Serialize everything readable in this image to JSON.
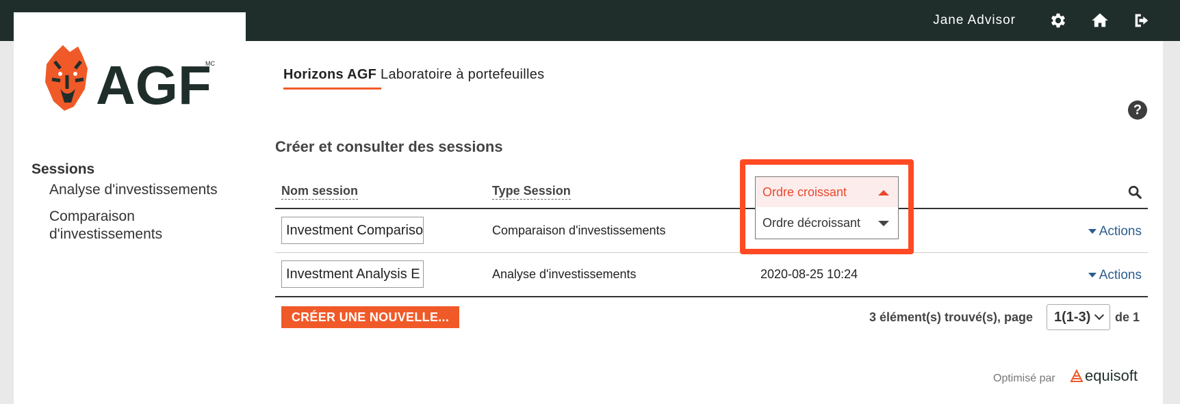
{
  "header": {
    "user_name": "Jane Advisor",
    "icons": [
      "gear-icon",
      "home-icon",
      "logout-icon"
    ]
  },
  "brand": {
    "logo_text": "AGF",
    "logo_mark": "MC",
    "accent_color": "#f05a28",
    "dark_color": "#1f2e2b"
  },
  "sidebar": {
    "title": "Sessions",
    "items": [
      {
        "label": "Analyse d'investissements"
      },
      {
        "label": "Comparaison d'investissements"
      }
    ]
  },
  "app": {
    "title_bold": "Horizons AGF",
    "title_rest": " Laboratoire à portefeuilles"
  },
  "main": {
    "section_title": "Créer et consulter des sessions",
    "columns": {
      "name": "Nom session",
      "type": "Type Session"
    },
    "sort_dropdown": {
      "options": [
        "Ordre croissant",
        "Ordre décroissant"
      ],
      "selected": "Ordre croissant"
    },
    "rows": [
      {
        "name": "Investment Comparison",
        "type": "Comparaison d'investissements",
        "date": "",
        "actions": "Actions"
      },
      {
        "name": "Investment Analysis E",
        "type": "Analyse d'investissements",
        "date": "2020-08-25 10:24",
        "actions": "Actions"
      }
    ],
    "create_button": "CRÉER UNE NOUVELLE...",
    "pager": {
      "found_text": "3 élément(s) trouvé(s), page",
      "page_value": "1(1-3)",
      "of_text": "de 1"
    }
  },
  "footer": {
    "optimized_by": "Optimisé par",
    "vendor": "equisoft"
  }
}
